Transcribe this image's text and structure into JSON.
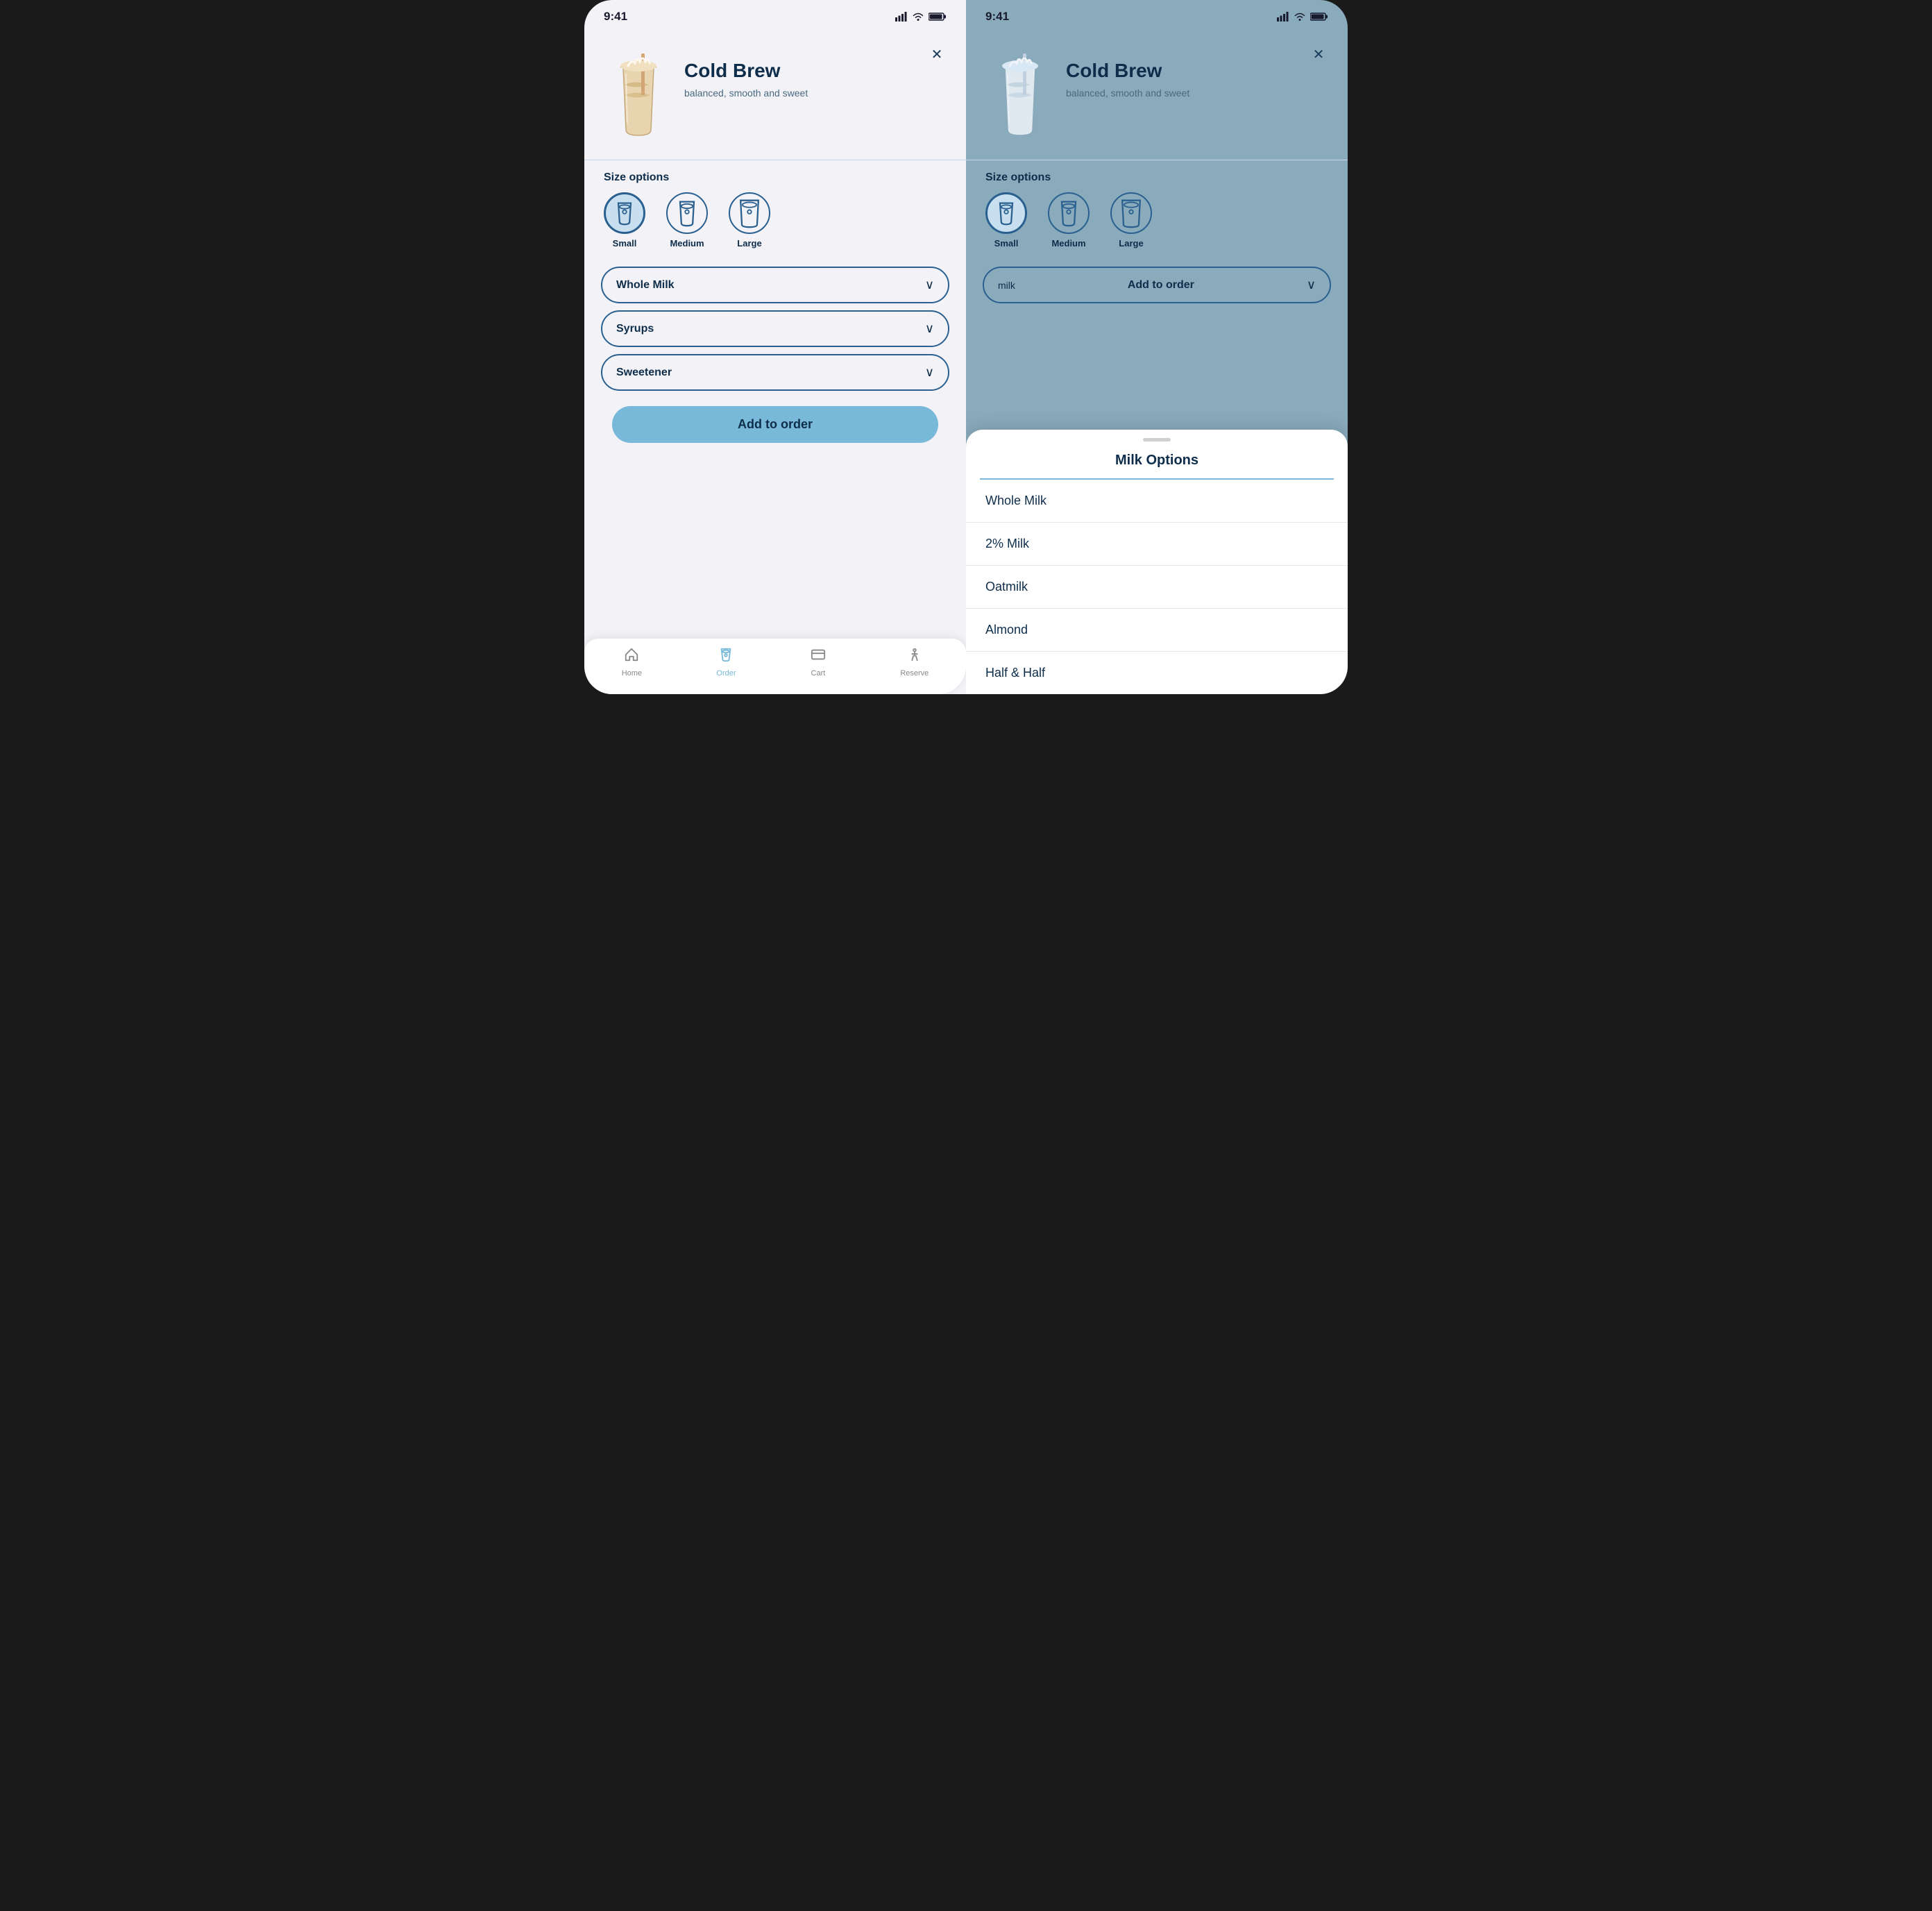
{
  "left_screen": {
    "status_time": "9:41",
    "product_name": "Cold Brew",
    "product_desc": "balanced, smooth and sweet",
    "section_size_label": "Size options",
    "sizes": [
      {
        "label": "Small",
        "selected": true
      },
      {
        "label": "Medium",
        "selected": false
      },
      {
        "label": "Large",
        "selected": false
      }
    ],
    "dropdowns": [
      {
        "label": "Whole Milk"
      },
      {
        "label": "Syrups"
      },
      {
        "label": "Sweetener"
      }
    ],
    "add_to_order": "Add to order",
    "nav_items": [
      {
        "label": "Home",
        "active": false
      },
      {
        "label": "Order",
        "active": true
      },
      {
        "label": "Cart",
        "active": false
      },
      {
        "label": "Reserve",
        "active": false
      }
    ]
  },
  "right_screen": {
    "status_time": "9:41",
    "product_name": "Cold Brew",
    "product_desc": "balanced, smooth and sweet",
    "section_size_label": "Size options",
    "sizes": [
      {
        "label": "Small",
        "selected": true
      },
      {
        "label": "Medium",
        "selected": false
      },
      {
        "label": "Large",
        "selected": false
      }
    ],
    "order_bar": {
      "milk_label": "milk",
      "add_label": "Add to order"
    },
    "modal": {
      "title": "Milk Options",
      "options": [
        "Whole Milk",
        "2% Milk",
        "Oatmilk",
        "Almond",
        "Half & Half"
      ]
    }
  }
}
